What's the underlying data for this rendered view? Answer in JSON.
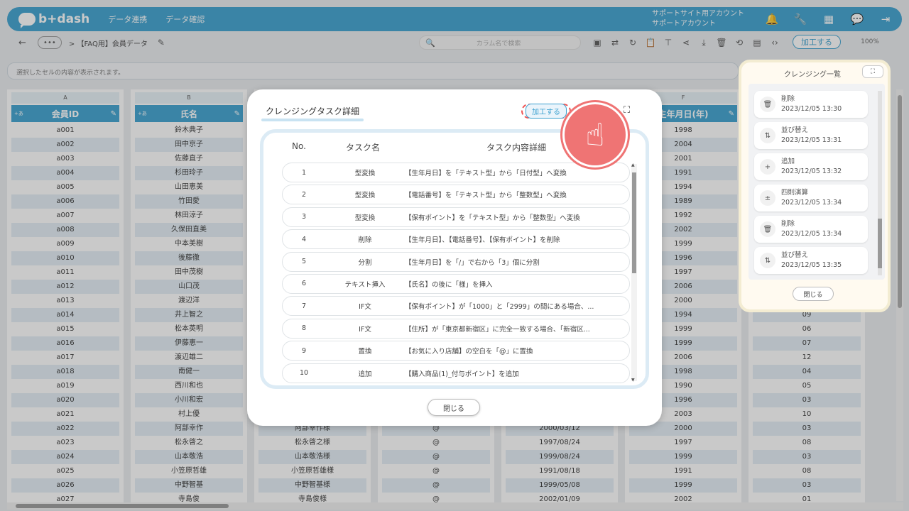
{
  "header": {
    "logo": "b+dash",
    "nav": [
      "データ連携",
      "データ確認"
    ],
    "account_line1": "サポートサイト用アカウント",
    "account_line2": "サポートアカウント",
    "icons": [
      "bell-icon",
      "wrench-icon",
      "grid-icon",
      "chat-icon",
      "logout-icon"
    ]
  },
  "toolbar": {
    "back": "←",
    "dots": "•••",
    "breadcrumb": "> 【FAQ用】会員データ",
    "search_placeholder": "カラム名で検索",
    "process_label": "加工する",
    "zoom": "100%"
  },
  "cellbar": {
    "placeholder": "選択したセルの内容が表示されます。"
  },
  "grid": {
    "columns": [
      {
        "letter": "A",
        "header": "会員ID",
        "tag": "+あ"
      },
      {
        "letter": "B",
        "header": "氏名",
        "tag": "+あ"
      },
      {
        "letter": "",
        "header": "",
        "tag": ""
      },
      {
        "letter": "",
        "header": "",
        "tag": ""
      },
      {
        "letter": "",
        "header": "",
        "tag": ""
      },
      {
        "letter": "F",
        "header": "生年月日(年)",
        "tag": ""
      },
      {
        "letter": "",
        "header": "",
        "tag": ""
      }
    ],
    "col_a": [
      "a001",
      "a002",
      "a003",
      "a004",
      "a005",
      "a006",
      "a007",
      "a008",
      "a009",
      "a010",
      "a011",
      "a012",
      "a013",
      "a014",
      "a015",
      "a016",
      "a017",
      "a018",
      "a019",
      "a020",
      "a021",
      "a022",
      "a023",
      "a024",
      "a025",
      "a026",
      "a027"
    ],
    "col_b": [
      "鈴木典子",
      "田中京子",
      "佐藤直子",
      "杉田玲子",
      "山田恵美",
      "竹田愛",
      "林田涼子",
      "久保田直美",
      "中本美樹",
      "後藤徹",
      "田中茂樹",
      "山口茂",
      "渡辺洋",
      "井上智之",
      "松本英明",
      "伊藤恵一",
      "渡辺雄二",
      "南健一",
      "西川和也",
      "小川和宏",
      "村上優",
      "阿部幸作",
      "松永啓之",
      "山本敬浩",
      "小笠原哲雄",
      "中野智基",
      "寺島俊"
    ],
    "col_c": [
      "",
      "",
      "",
      "",
      "",
      "",
      "",
      "",
      "",
      "",
      "",
      "",
      "",
      "",
      "",
      "",
      "",
      "",
      "",
      "",
      "",
      "阿部幸作様",
      "松永啓之様",
      "山本敬浩様",
      "小笠原哲雄様",
      "中野智基様",
      "寺島俊様"
    ],
    "col_d": [
      "",
      "",
      "",
      "",
      "",
      "",
      "",
      "",
      "",
      "",
      "",
      "",
      "",
      "",
      "",
      "",
      "",
      "",
      "",
      "",
      "",
      "@",
      "@",
      "@",
      "@",
      "@",
      "@"
    ],
    "col_e": [
      "",
      "",
      "",
      "",
      "",
      "",
      "",
      "",
      "",
      "",
      "",
      "",
      "",
      "",
      "",
      "",
      "",
      "",
      "",
      "",
      "",
      "2000/03/12",
      "1997/08/24",
      "1999/08/24",
      "1991/08/18",
      "1999/05/08",
      "2002/01/09"
    ],
    "col_f": [
      "1998",
      "2004",
      "2001",
      "1991",
      "1994",
      "1989",
      "1992",
      "2002",
      "1999",
      "1996",
      "1997",
      "2006",
      "2000",
      "1994",
      "1999",
      "1999",
      "2006",
      "1998",
      "1990",
      "1996",
      "2003",
      "2000",
      "1997",
      "1999",
      "1991",
      "1999",
      "2002"
    ],
    "col_g": [
      "",
      "",
      "",
      "",
      "",
      "",
      "",
      "",
      "",
      "",
      "",
      "",
      "",
      "09",
      "06",
      "07",
      "12",
      "04",
      "05",
      "03",
      "10",
      "03",
      "08",
      "03",
      "08",
      "03",
      "01"
    ]
  },
  "modal": {
    "title": "クレンジングタスク詳細",
    "process_label": "加工する",
    "headers": {
      "no": "No.",
      "name": "タスク名",
      "detail": "タスク内容詳細"
    },
    "tasks": [
      {
        "no": "1",
        "name": "型変換",
        "detail": "【生年月日】を「テキスト型」から「日付型」へ変換"
      },
      {
        "no": "2",
        "name": "型変換",
        "detail": "【電話番号】を「テキスト型」から「整数型」へ変換"
      },
      {
        "no": "3",
        "name": "型変換",
        "detail": "【保有ポイント】を「テキスト型」から「整数型」へ変換"
      },
      {
        "no": "4",
        "name": "削除",
        "detail": "【生年月日】、【電話番号】、【保有ポイント】を削除"
      },
      {
        "no": "5",
        "name": "分割",
        "detail": "【生年月日】を「/」で右から「3」個に分割"
      },
      {
        "no": "6",
        "name": "テキスト挿入",
        "detail": "【氏名】の後に「様」を挿入"
      },
      {
        "no": "7",
        "name": "IF文",
        "detail": "【保有ポイント】が「1000」と「2999」の間にある場合、..."
      },
      {
        "no": "8",
        "name": "IF文",
        "detail": "【住所】が「東京都新宿区」に完全一致する場合、「新宿区..."
      },
      {
        "no": "9",
        "name": "置換",
        "detail": "【お気に入り店舗】の空白を「@」に置換"
      },
      {
        "no": "10",
        "name": "追加",
        "detail": "【購入商品(1)_付与ポイント】を追加"
      }
    ],
    "close_label": "閉じる"
  },
  "panel": {
    "title": "クレンジング一覧",
    "close_label": "閉じる",
    "items": [
      {
        "name": "削除",
        "time": "2023/12/05 13:30",
        "icon": "trash-icon"
      },
      {
        "name": "並び替え",
        "time": "2023/12/05 13:31",
        "icon": "sort-icon"
      },
      {
        "name": "追加",
        "time": "2023/12/05 13:32",
        "icon": "plus-icon"
      },
      {
        "name": "四則演算",
        "time": "2023/12/05 13:34",
        "icon": "arithmetic-icon"
      },
      {
        "name": "削除",
        "time": "2023/12/05 13:34",
        "icon": "trash-icon"
      },
      {
        "name": "並び替え",
        "time": "2023/12/05 13:35",
        "icon": "sort-icon"
      }
    ]
  }
}
